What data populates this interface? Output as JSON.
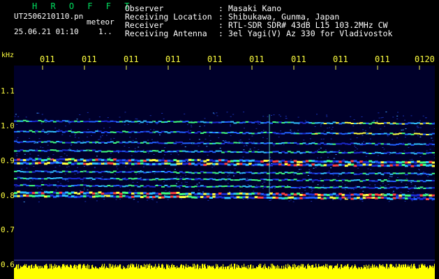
{
  "header": {
    "brand": "H R O F F T",
    "filename": "UT2506210110.pn",
    "meteor_label": "meteor",
    "datetime": "25.06.21 01:10",
    "dots": "1..",
    "rows": [
      {
        "label": "Observer",
        "value": "Masaki Kano"
      },
      {
        "label": "Receiving Location",
        "value": "Shibukawa, Gunma, Japan"
      },
      {
        "label": "Receiver",
        "value": "RTL-SDR SDR# 43dB L15 103.2MHz CW"
      },
      {
        "label": "Receiving Antenna",
        "value": "3el Yagi(V) Az 330 for Vladivostok"
      }
    ]
  },
  "colors": {
    "brand": "#00e060",
    "axis_text": "#ffff40",
    "background": "#000000",
    "spectrogram_bg": "#00002a",
    "signal_bar": "#ffff00"
  },
  "chart_data": {
    "type": "heatmap",
    "ylabel": "kHz",
    "yticks": [
      "1.1",
      "1.0",
      "0.9",
      "0.8",
      "0.7",
      "0.6"
    ],
    "ylim": [
      0.6,
      1.1
    ],
    "xticks": [
      "011",
      "011",
      "011",
      "011",
      "011",
      "011",
      "011",
      "011",
      "011",
      "0120"
    ],
    "bands_khz": [
      1.015,
      0.985,
      0.955,
      0.93,
      0.905,
      0.895,
      0.87,
      0.85,
      0.83,
      0.81,
      0.8
    ]
  }
}
